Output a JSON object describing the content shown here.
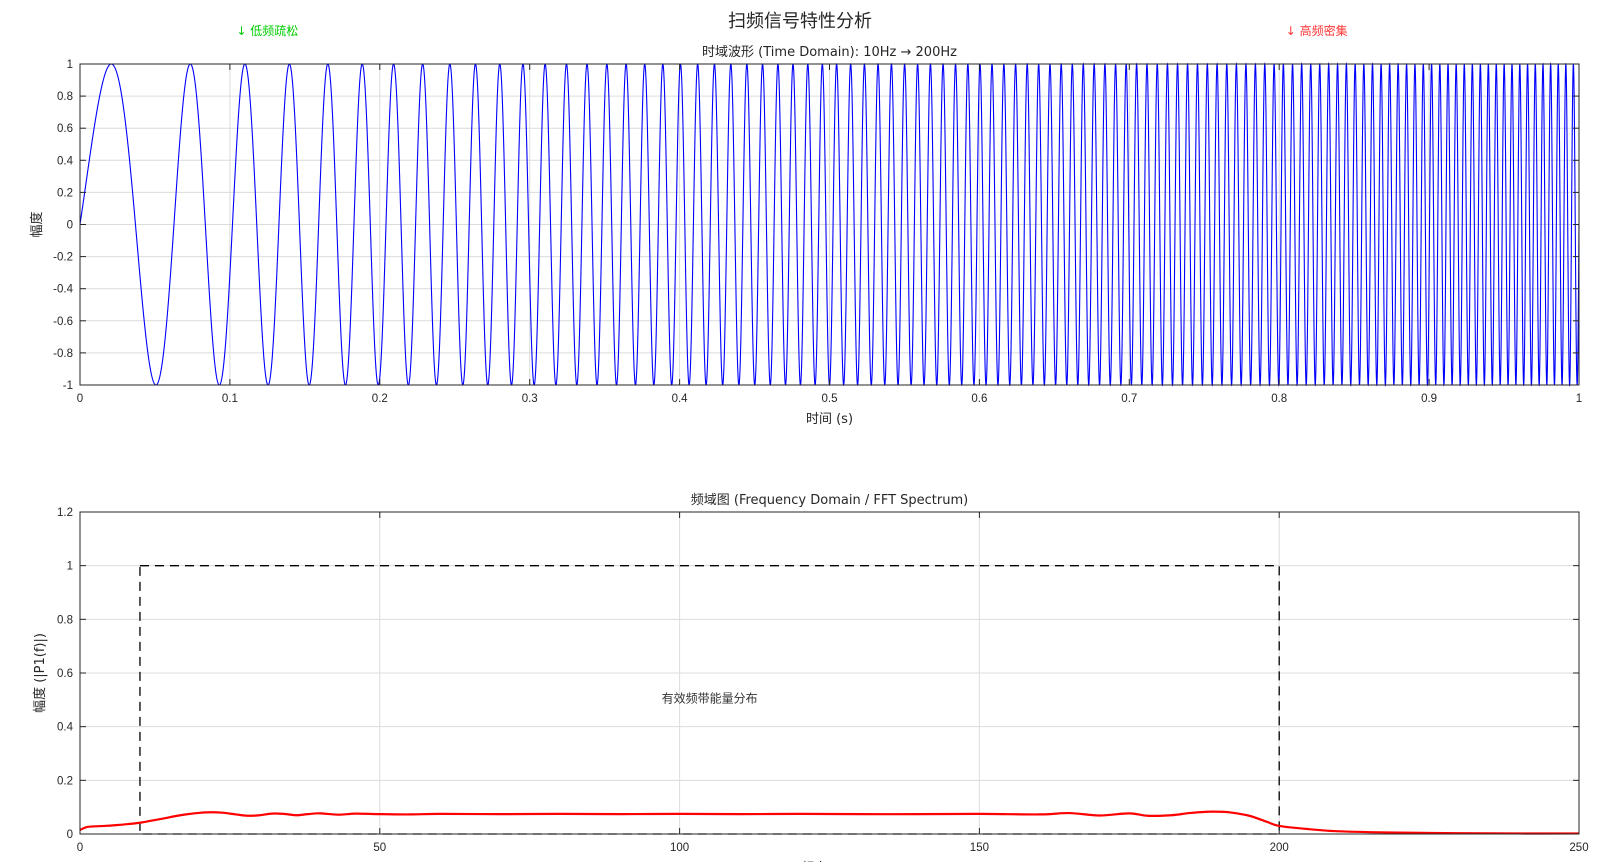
{
  "figure": {
    "suptitle": "扫频信号特性分析"
  },
  "chart_data": [
    {
      "type": "line",
      "title": "时域波形 (Time Domain): 10Hz → 200Hz",
      "xlabel": "时间 (s)",
      "ylabel": "幅度",
      "xlim": [
        0,
        1
      ],
      "ylim": [
        -1,
        1
      ],
      "xticks": [
        0,
        0.1,
        0.2,
        0.3,
        0.4,
        0.5,
        0.6,
        0.7,
        0.8,
        0.9,
        1
      ],
      "yticks": [
        -1,
        -0.8,
        -0.6,
        -0.4,
        -0.2,
        0,
        0.2,
        0.4,
        0.6,
        0.8,
        1
      ],
      "grid": true,
      "series": [
        {
          "color": "#0000ff",
          "function": "sin(2π(f0·t + (f1−f0)/2·t²))",
          "f0_hz": 10,
          "f1_hz": 200,
          "t_start": 0,
          "t_end": 1
        }
      ],
      "annotations": [
        {
          "text": "↓ 低频疏松",
          "color": "#00cc00",
          "x": 0.125
        },
        {
          "text": "↓ 高频密集",
          "color": "#ff3333",
          "x": 0.825
        }
      ]
    },
    {
      "type": "line",
      "title": "频域图 (Frequency Domain / FFT Spectrum)",
      "xlabel": "频率 (Hz)",
      "ylabel": "幅度 (|P1(f)|)",
      "xlim": [
        0,
        250
      ],
      "ylim": [
        0,
        1.2
      ],
      "xticks": [
        0,
        50,
        100,
        150,
        200,
        250
      ],
      "yticks": [
        0,
        0.2,
        0.4,
        0.6,
        0.8,
        1,
        1.2
      ],
      "grid": true,
      "series": [
        {
          "color": "#ff0000",
          "x": [
            0,
            1,
            2,
            4,
            6,
            8,
            10,
            12,
            14,
            16,
            18,
            20,
            22,
            24,
            26,
            28,
            30,
            32,
            34,
            36,
            38,
            40,
            43,
            46,
            50,
            55,
            60,
            70,
            80,
            90,
            100,
            110,
            120,
            130,
            140,
            150,
            160,
            165,
            170,
            175,
            178,
            182,
            185,
            188,
            190,
            192,
            195,
            198,
            200,
            205,
            210,
            220,
            230,
            240,
            250
          ],
          "y": [
            0.015,
            0.025,
            0.028,
            0.03,
            0.033,
            0.037,
            0.042,
            0.05,
            0.058,
            0.067,
            0.074,
            0.079,
            0.081,
            0.079,
            0.073,
            0.068,
            0.07,
            0.076,
            0.075,
            0.07,
            0.074,
            0.077,
            0.072,
            0.076,
            0.074,
            0.073,
            0.075,
            0.074,
            0.075,
            0.074,
            0.075,
            0.074,
            0.075,
            0.074,
            0.074,
            0.075,
            0.073,
            0.078,
            0.069,
            0.077,
            0.068,
            0.07,
            0.078,
            0.083,
            0.083,
            0.08,
            0.068,
            0.045,
            0.03,
            0.018,
            0.01,
            0.005,
            0.003,
            0.002,
            0.002
          ]
        }
      ],
      "highlight_box": {
        "x": [
          10,
          200
        ],
        "y": [
          0,
          1
        ],
        "style": "dashed",
        "color": "#000000",
        "label": "有效频带能量分布",
        "label_at": [
          105,
          0.49
        ]
      }
    }
  ]
}
